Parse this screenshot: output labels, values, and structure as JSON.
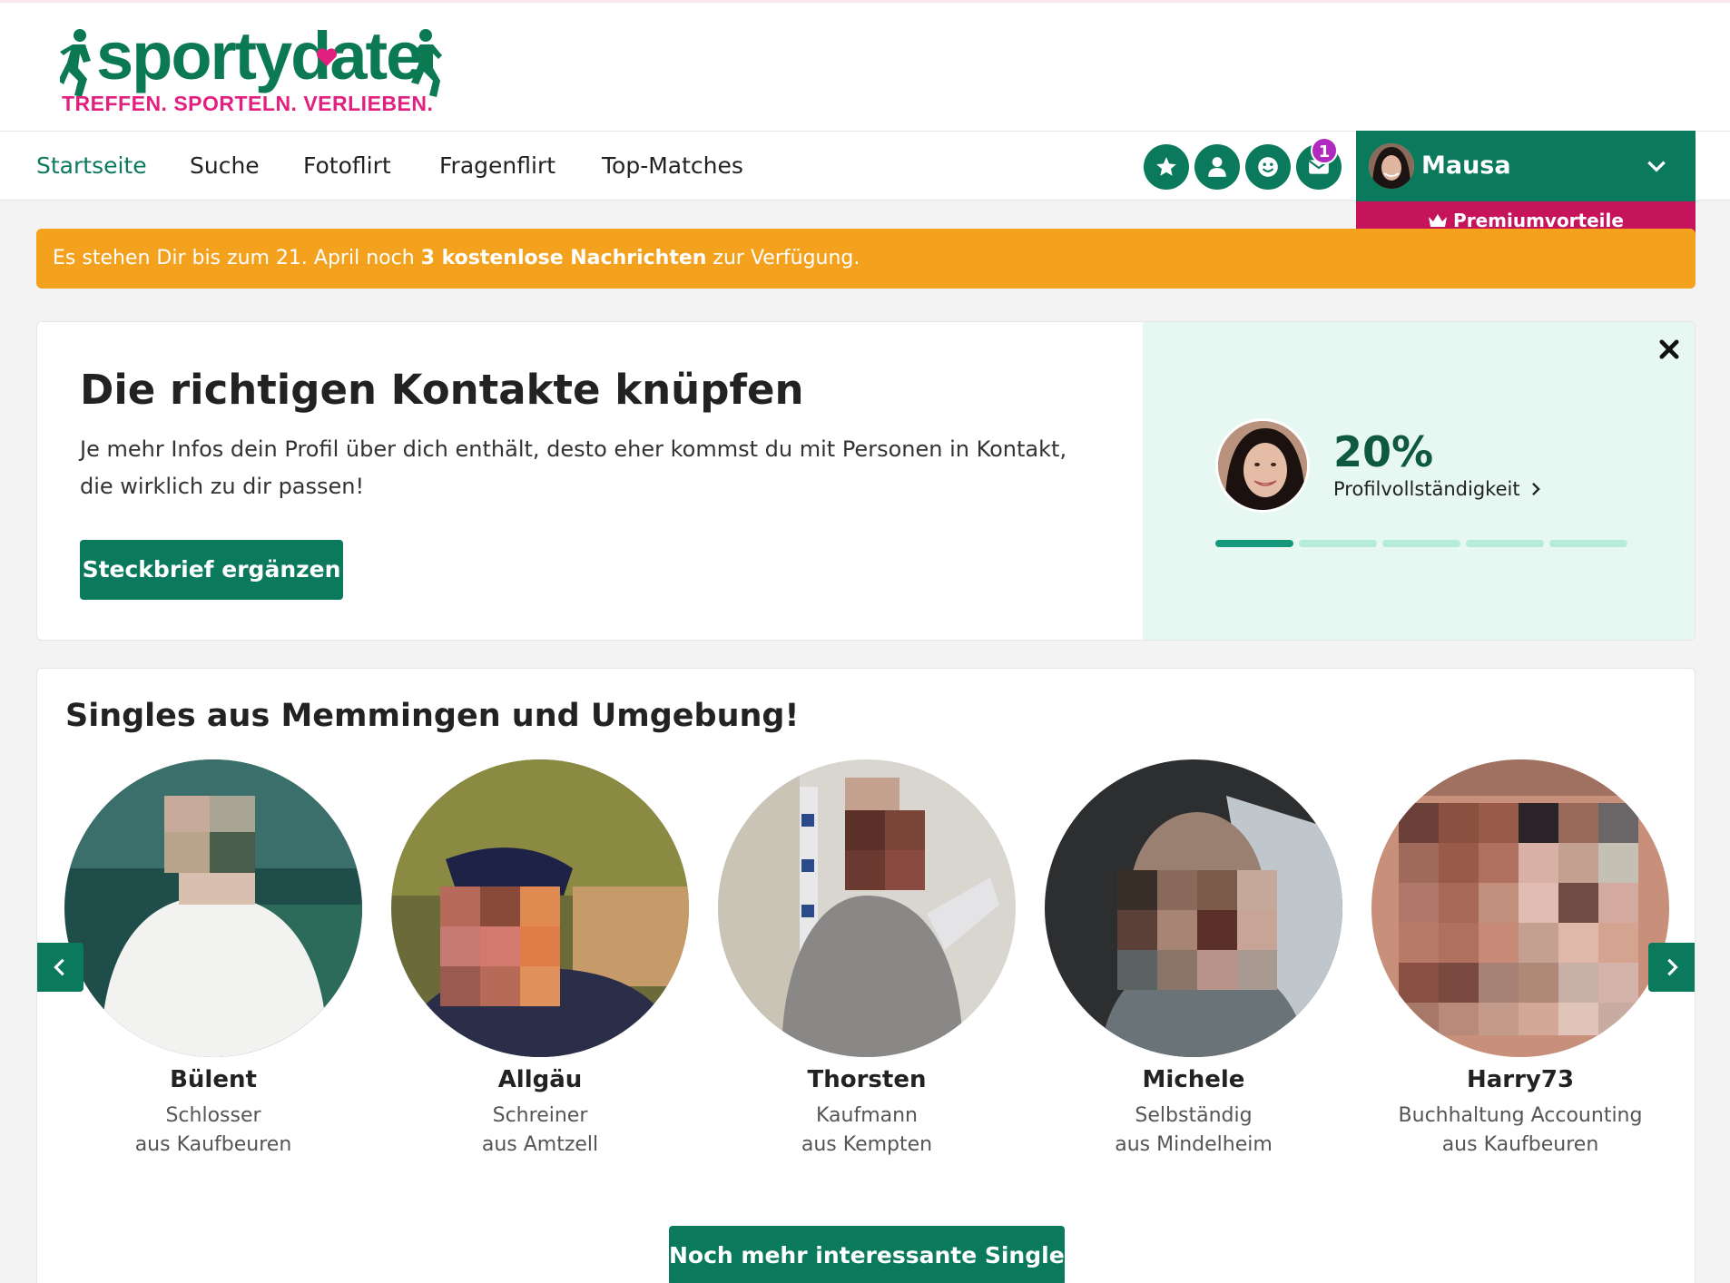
{
  "brand": {
    "logo_text": "sportydate",
    "slogan": "TREFFEN. SPORTELN. VERLIEBEN.",
    "green": "#0b7a53",
    "pink": "#e2207f"
  },
  "nav": {
    "items": [
      {
        "label": "Startseite",
        "active": true
      },
      {
        "label": "Suche",
        "active": false
      },
      {
        "label": "Fotoflirt",
        "active": false
      },
      {
        "label": "Fragenflirt",
        "active": false
      },
      {
        "label": "Top-Matches",
        "active": false
      }
    ],
    "icons": [
      "star-icon",
      "user-icon",
      "smiley-icon",
      "envelope-icon"
    ],
    "message_badge": "1"
  },
  "user": {
    "name": "Mausa",
    "premium_label": "Premiumvorteile"
  },
  "alert": {
    "prefix": "Es stehen Dir bis zum 21. April noch ",
    "highlight": "3 kostenlose Nachrichten",
    "suffix": " zur Verfügung.",
    "color": "#f4a21e"
  },
  "profile_card": {
    "title": "Die richtigen Kontakte knüpfen",
    "text": "Je mehr Infos dein Profil über dich enthält, desto eher kommst du mit Personen in Kontakt, die wirklich zu dir passen!",
    "button": "Steckbrief ergänzen",
    "completeness_value": "20%",
    "completeness_label": "Profilvollständigkeit",
    "completeness_fraction": 0.2
  },
  "singles": {
    "title": "Singles aus Memmingen und Umgebung!",
    "items": [
      {
        "name": "Bülent",
        "job": "Schlosser",
        "city": "aus Kaufbeuren"
      },
      {
        "name": "Allgäu",
        "job": "Schreiner",
        "city": "aus Amtzell"
      },
      {
        "name": "Thorsten",
        "job": "Kaufmann",
        "city": "aus Kempten"
      },
      {
        "name": "Michele",
        "job": "Selbständig",
        "city": "aus Mindelheim"
      },
      {
        "name": "Harry73",
        "job": "Buchhaltung Accounting",
        "city": "aus Kaufbeuren"
      }
    ],
    "more_button": "Noch mehr interessante Singles"
  }
}
